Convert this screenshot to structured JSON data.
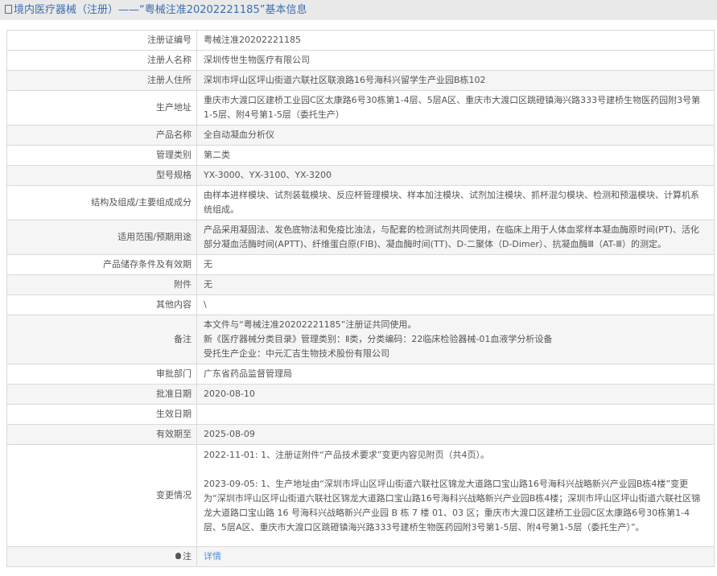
{
  "header": {
    "title": "境内医疗器械（注册）——“粤械注准20202221185”基本信息",
    "icon": "document-icon"
  },
  "rows": [
    {
      "label": "注册证编号",
      "value": "粤械注准20202221185"
    },
    {
      "label": "注册人名称",
      "value": "深圳传世生物医疗有限公司"
    },
    {
      "label": "注册人住所",
      "value": "深圳市坪山区坪山街道六联社区联浪路16号海科兴留学生产业园B栋102"
    },
    {
      "label": "生产地址",
      "value": "重庆市大渡口区建桥工业园C区太康路6号30栋第1-4层、5层A区、重庆市大渡口区跳磴镇海兴路333号建桥生物医药园附3号第1-5层、附4号第1-5层（委托生产）"
    },
    {
      "label": "产品名称",
      "value": "全自动凝血分析仪"
    },
    {
      "label": "管理类别",
      "value": "第二类"
    },
    {
      "label": "型号规格",
      "value": "YX-3000、YX-3100、YX-3200"
    },
    {
      "label": "结构及组成/主要组成成分",
      "value": "由样本进样模块、试剂装载模块、反应杯管理模块、样本加注模块、试剂加注模块、抓杯混匀模块、检测和预温模块、计算机系统组成。"
    },
    {
      "label": "适用范围/预期用途",
      "value": "产品采用凝固法、发色底物法和免疫比浊法，与配套的检测试剂共同使用，在临床上用于人体血浆样本凝血酶原时间(PT)、活化部分凝血活酶时间(APTT)、纤维蛋白原(FIB)、凝血酶时间(TT)、D-二聚体（D-Dimer）、抗凝血酶Ⅲ（AT-Ⅲ）的测定。"
    },
    {
      "label": "产品储存条件及有效期",
      "value": "无"
    },
    {
      "label": "附件",
      "value": "无"
    },
    {
      "label": "其他内容",
      "value": "\\"
    },
    {
      "label": "备注",
      "lines": [
        "本文件与“粤械注准20202221185”注册证共同使用。",
        "新《医疗器械分类目录》管理类别：Ⅱ类，分类编码：22临床检验器械-01血液学分析设备",
        "受托生产企业：中元汇吉生物技术股份有限公司"
      ]
    },
    {
      "label": "审批部门",
      "value": "广东省药品监督管理局"
    },
    {
      "label": "批准日期",
      "value": "2020-08-10"
    },
    {
      "label": "生效日期",
      "value": ""
    },
    {
      "label": "有效期至",
      "value": "2025-08-09"
    },
    {
      "label": "变更情况",
      "lines": [
        "2022-11-01: 1、注册证附件“产品技术要求”变更内容见附页（共4页）。",
        "2023-09-05: 1、生产地址由“深圳市坪山区坪山街道六联社区锦龙大道路口宝山路16号海科兴战略新兴产业园B栋4楼”变更为“深圳市坪山区坪山街道六联社区锦龙大道路口宝山路16号海科兴战略新兴产业园B栋4楼；深圳市坪山区坪山街道六联社区锦龙大道路口宝山路 16 号海科兴战略新兴产业园 B 栋 7 楼 01、03 区；重庆市大渡口区建桥工业园C区太康路6号30栋第1-4层、5层A区、重庆市大渡口区跳磴镇海兴路333号建桥生物医药园附3号第1-5层、附4号第1-5层（委托生产）”。"
      ]
    },
    {
      "label": "注",
      "value": "详情",
      "icon": "lightbulb-icon"
    }
  ]
}
